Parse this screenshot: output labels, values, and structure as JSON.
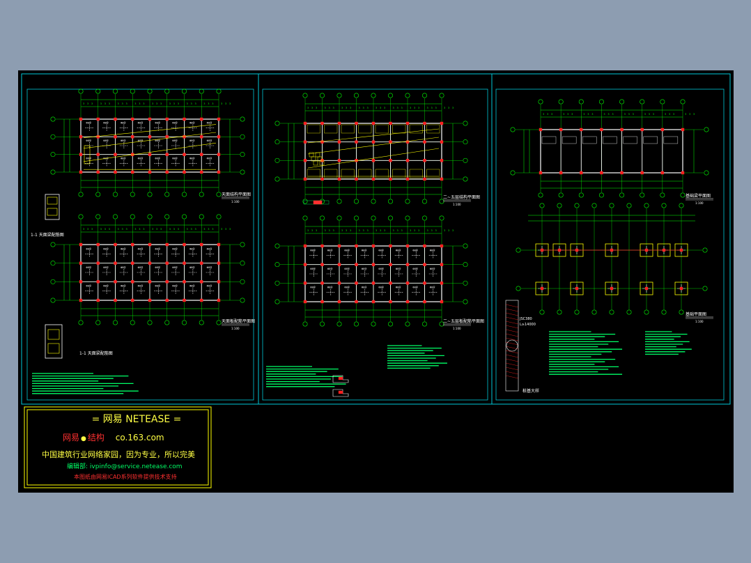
{
  "colors": {
    "background": "#8d9db1",
    "canvas": "#000000",
    "frame": "#00c8d8",
    "grid": "#00ff00",
    "walls": "#ffffff",
    "columns": "#ff2020",
    "beams": "#ffff00",
    "title_block": "#ffff00",
    "text_green": "#00ff66",
    "text_red": "#ff3030"
  },
  "sheets": [
    {
      "id": "left",
      "plans": [
        {
          "label": "天面结构平面图",
          "scale": "1:100"
        },
        {
          "label": "天面板配筋平面图",
          "scale": "1:100"
        }
      ],
      "details": [
        {
          "label": "1-1 天面梁配筋图"
        },
        {
          "label": "1-1 天面梁配筋图"
        }
      ],
      "notes_icon": "notes-text-block"
    },
    {
      "id": "middle",
      "plans": [
        {
          "label": "二~五层结构平面图",
          "scale": "1:100"
        },
        {
          "label": "二~五层板配筋平面图",
          "scale": "1:100"
        }
      ],
      "notes_icon": "notes-text-block"
    },
    {
      "id": "right",
      "plans": [
        {
          "label": "基础梁平面图",
          "scale": "1:100"
        },
        {
          "label": "基础平面图",
          "scale": "1:100"
        }
      ],
      "details": [
        {
          "label": "桩基大样"
        }
      ],
      "pile_labels": [
        "JSC380",
        "L≥14000"
      ],
      "notes_icon": "notes-text-block"
    }
  ],
  "title_block": {
    "line1": "= 网易  NETEASE =",
    "line2_red": "网易",
    "line2_dot": "●",
    "line2_red_b": "结构",
    "line2_url": "co.163.com",
    "line3": "中国建筑行业网络家园，因为专业，所以完美",
    "line4_label": "编辑部:",
    "line4_email": "ivpinfo@service.netease.com",
    "line5": "本图纸由网易ICAD系列软件提供技术支持"
  }
}
